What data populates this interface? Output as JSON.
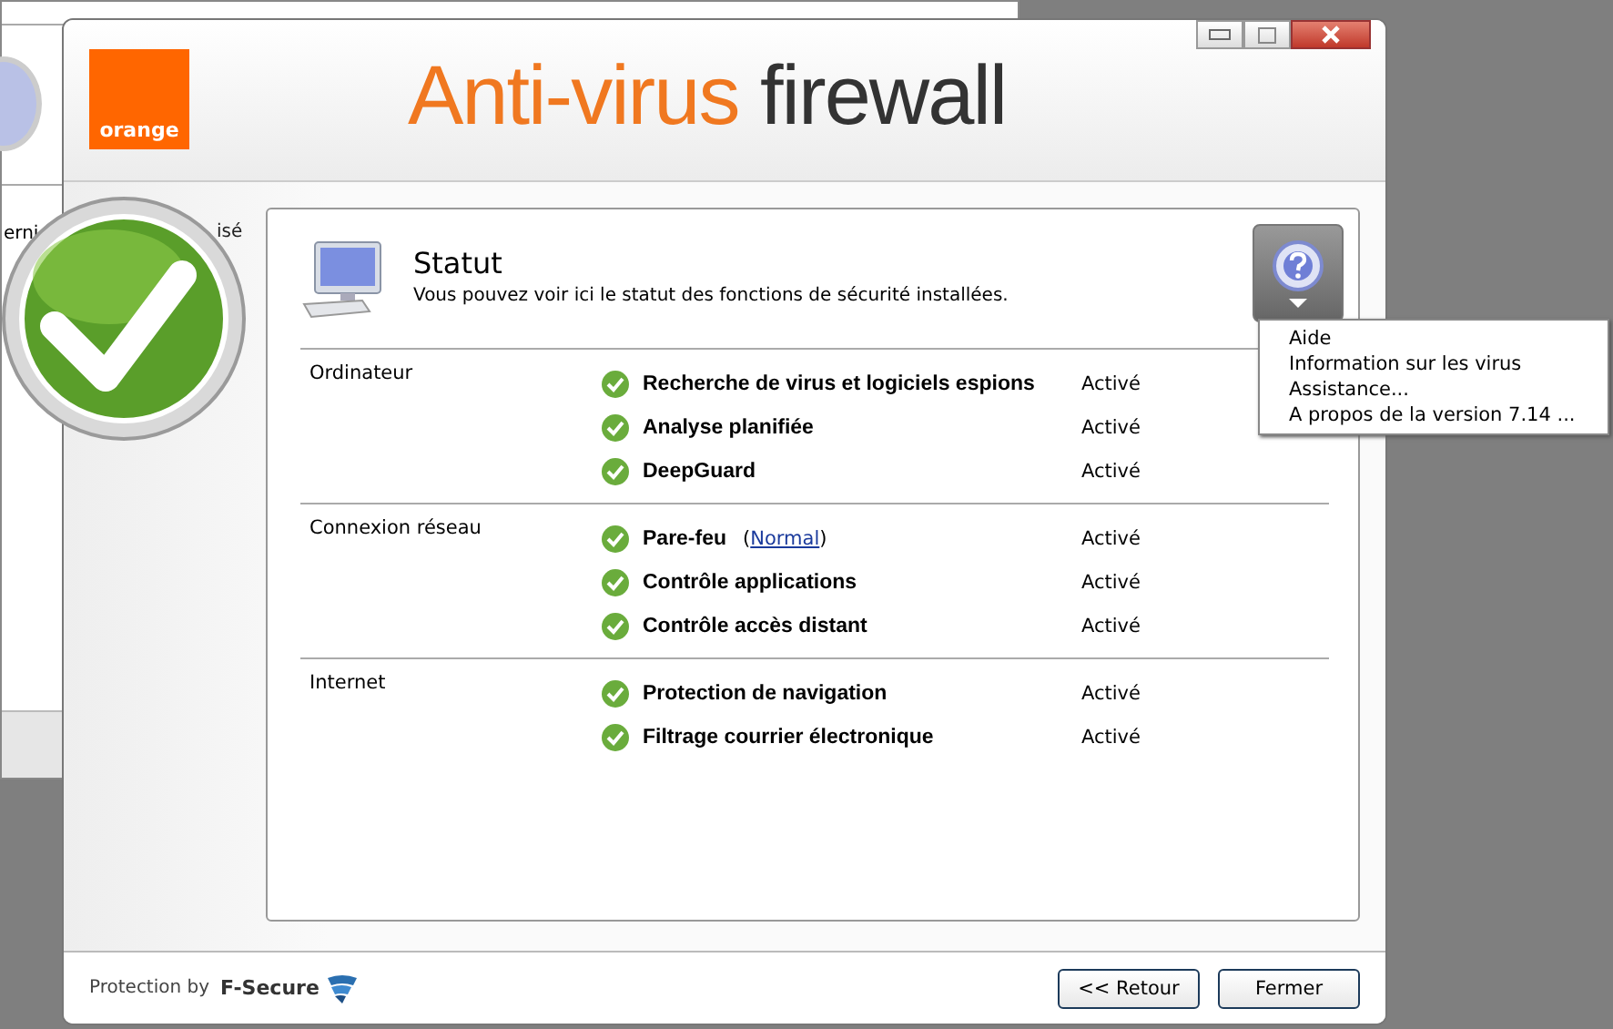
{
  "background_window": {
    "fragments": [
      "erni",
      "isé"
    ]
  },
  "window": {
    "logo": "orange",
    "title_main": "Anti-virus",
    "title_rest": "firewall"
  },
  "status": {
    "title": "Statut",
    "description": "Vous pouvez voir ici le statut des fonctions de sécurité installées."
  },
  "help_menu": {
    "expanded": true,
    "items": [
      "Aide",
      "Information sur les virus",
      "Assistance...",
      "A propos de la version 7.14 ..."
    ]
  },
  "sections": [
    {
      "name": "Ordinateur",
      "features": [
        {
          "name": "Recherche de virus et logiciels espions",
          "status": "Activé",
          "ok": true
        },
        {
          "name": "Analyse planifiée",
          "status": "Activé",
          "ok": true
        },
        {
          "name": "DeepGuard",
          "status": "Activé",
          "ok": true
        }
      ]
    },
    {
      "name": "Connexion réseau",
      "features": [
        {
          "name": "Pare-feu",
          "link_open": "(",
          "link": "Normal",
          "link_close": ")",
          "status": "Activé",
          "ok": true
        },
        {
          "name": "Contrôle applications",
          "status": "Activé",
          "ok": true
        },
        {
          "name": "Contrôle accès distant",
          "status": "Activé",
          "ok": true
        }
      ]
    },
    {
      "name": "Internet",
      "features": [
        {
          "name": "Protection de navigation",
          "status": "Activé",
          "ok": true
        },
        {
          "name": "Filtrage courrier électronique",
          "status": "Activé",
          "ok": true
        }
      ]
    }
  ],
  "footer": {
    "protection_by": "Protection by",
    "brand": "F-Secure",
    "buttons": [
      "<< Retour",
      "Fermer"
    ]
  }
}
